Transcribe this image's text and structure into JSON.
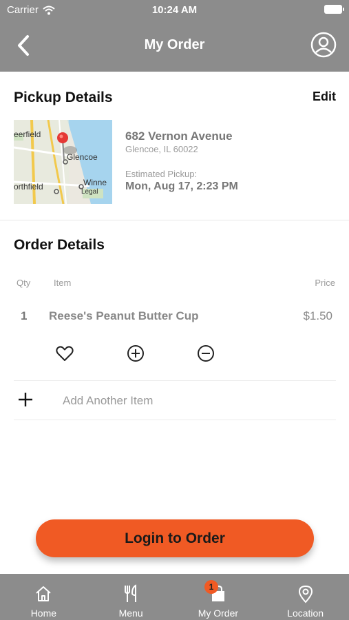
{
  "status_bar": {
    "carrier": "Carrier",
    "time": "10:24 AM"
  },
  "header": {
    "title": "My Order",
    "back_icon": "chevron-left-icon",
    "profile_icon": "user-circle-icon"
  },
  "pickup": {
    "title": "Pickup Details",
    "edit_label": "Edit",
    "map_labels": {
      "town1": "eerfield",
      "town2": "Glencoe",
      "town3": "orthfield",
      "town4": "Winne",
      "legal": "Legal"
    },
    "address_line1": "682 Vernon Avenue",
    "address_line2": "Glencoe, IL 60022",
    "estimated_label": "Estimated Pickup:",
    "estimated_value": "Mon, Aug 17, 2:23 PM"
  },
  "order": {
    "title": "Order Details",
    "columns": {
      "qty": "Qty",
      "item": "Item",
      "price": "Price"
    },
    "items": [
      {
        "qty": "1",
        "name": "Reese's Peanut Butter Cup",
        "price": "$1.50"
      }
    ],
    "add_item_label": "Add Another Item"
  },
  "cta": {
    "login_label": "Login to Order"
  },
  "tabs": [
    {
      "label": "Home",
      "icon": "home-icon"
    },
    {
      "label": "Menu",
      "icon": "fork-knife-icon"
    },
    {
      "label": "My Order",
      "icon": "shopping-bag-icon",
      "badge": "1"
    },
    {
      "label": "Location",
      "icon": "map-pin-icon"
    }
  ],
  "colors": {
    "accent": "#f05a24",
    "bar": "#8c8c8c"
  }
}
